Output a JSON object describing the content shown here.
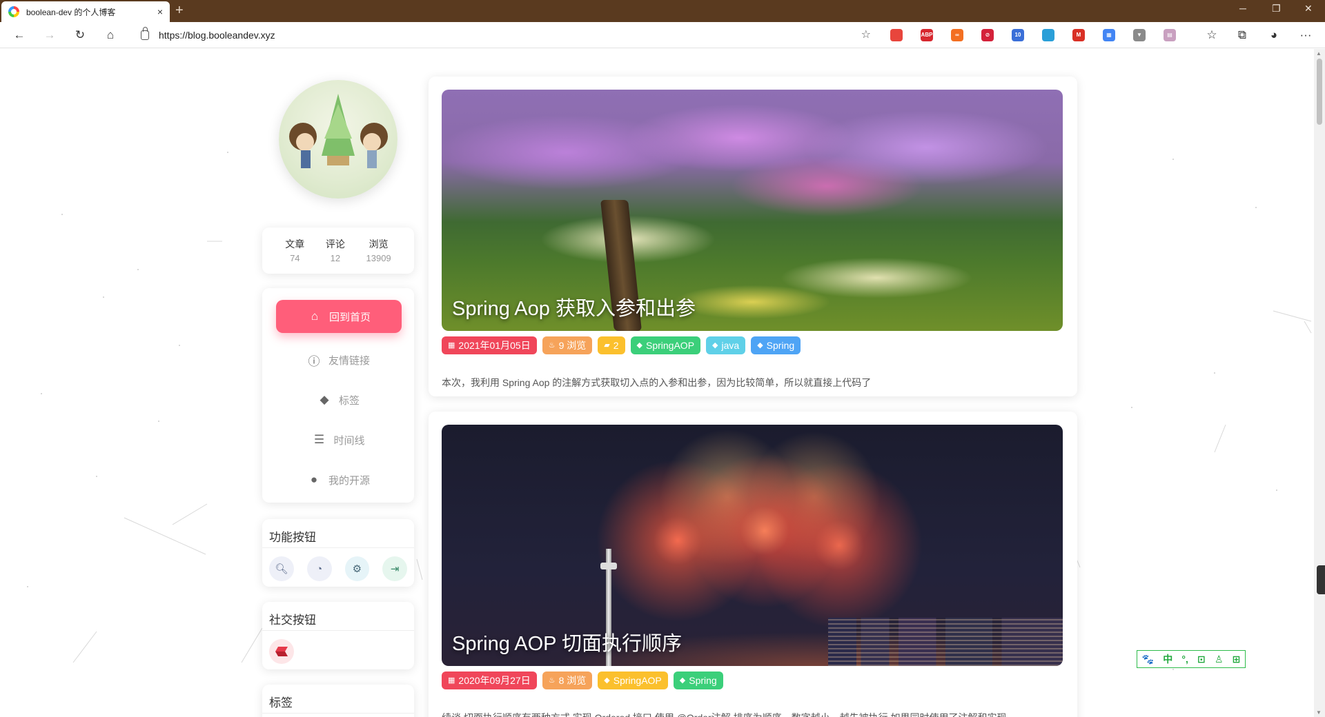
{
  "browser": {
    "tab_title": "boolean-dev 的个人博客",
    "tab_close": "×",
    "new_tab": "+",
    "url": "https://blog.booleandev.xyz",
    "window_controls": {
      "minimize": "─",
      "restore": "❐",
      "close": "✕"
    },
    "extensions": [
      {
        "name": "chrome-logo-icon",
        "color": "#e8453c",
        "label": ""
      },
      {
        "name": "adblock-plus-icon",
        "color": "#d7282f",
        "label": "ABP"
      },
      {
        "name": "infinity-icon",
        "color": "#f36f21",
        "label": "∞"
      },
      {
        "name": "block-icon",
        "color": "#d4223a",
        "label": "⊘"
      },
      {
        "name": "apps-badge-icon",
        "color": "#3a6fd8",
        "label": "10"
      },
      {
        "name": "shield-icon",
        "color": "#2a9fd8",
        "label": ""
      },
      {
        "name": "gmail-icon",
        "color": "#d93025",
        "label": "M"
      },
      {
        "name": "chart-icon",
        "color": "#4285f4",
        "label": "▦"
      },
      {
        "name": "vue-devtools-icon",
        "color": "#8a8a8a",
        "label": "▼"
      },
      {
        "name": "reader-icon",
        "color": "#c9a0c0",
        "label": "▤"
      }
    ]
  },
  "profile": {
    "stats": [
      {
        "label": "文章",
        "value": "74"
      },
      {
        "label": "评论",
        "value": "12"
      },
      {
        "label": "浏览",
        "value": "13909"
      }
    ]
  },
  "menu": [
    {
      "label": "回到首页",
      "icon": "home-icon",
      "glyph": "⌂",
      "active": true
    },
    {
      "label": "友情链接",
      "icon": "info-icon",
      "glyph": "ⓘ",
      "active": false
    },
    {
      "label": "标签",
      "icon": "tag-icon",
      "glyph": "◆",
      "active": false
    },
    {
      "label": "时间线",
      "icon": "list-icon",
      "glyph": "☰",
      "active": false
    },
    {
      "label": "我的开源",
      "icon": "github-icon",
      "glyph": "●",
      "active": false
    }
  ],
  "widgets": {
    "functions_title": "功能按钮",
    "function_buttons": [
      {
        "name": "search-button",
        "glyph": "🔍︎",
        "bg": "#eef0f8",
        "color": "#5a6a8a"
      },
      {
        "name": "rss-button",
        "glyph": "◔",
        "bg": "#eef0f8",
        "color": "#5a6a8a"
      },
      {
        "name": "settings-button",
        "glyph": "⚙",
        "bg": "#e6f4f8",
        "color": "#4a6a7a"
      },
      {
        "name": "logout-button",
        "glyph": "⇥",
        "bg": "#e6f6ee",
        "color": "#3a8a6a"
      }
    ],
    "social_title": "社交按钮",
    "tags_title": "标签"
  },
  "posts": [
    {
      "title": "Spring Aop 获取入参和出参",
      "cover": "flowers",
      "date": "2021年01月05日",
      "views": "9 浏览",
      "comments": "2",
      "tags": [
        {
          "label": "SpringAOP",
          "color": "#3bcf7a"
        },
        {
          "label": "java",
          "color": "#5fd0e8"
        },
        {
          "label": "Spring",
          "color": "#4ea4f5"
        }
      ],
      "excerpt": "本次，我利用 Spring Aop 的注解方式获取切入点的入参和出参，因为比较简单，所以就直接上代码了"
    },
    {
      "title": "Spring AOP 切面执行顺序",
      "cover": "fireworks",
      "date": "2020年09月27日",
      "views": "8 浏览",
      "tags": [
        {
          "label": "SpringAOP",
          "color": "#fbc02d"
        },
        {
          "label": "Spring",
          "color": "#3bcf7a"
        }
      ],
      "excerpt": "续谈 切面执行顺序有两种方式 实现 Ordered 接口 使用 @Order注解 排序为顺序，数字越小，越先被执行 如果同时使用了注解和实现"
    }
  ],
  "ime": [
    "🐾",
    "中",
    "°,",
    "⊡",
    "♙",
    "⊞"
  ],
  "colors": {
    "accent": "#ff5e7a",
    "date_tag": "#f0465a",
    "views_tag": "#f6a35a",
    "comments_tag": "#fbc02d",
    "ime": "#20a83c"
  }
}
